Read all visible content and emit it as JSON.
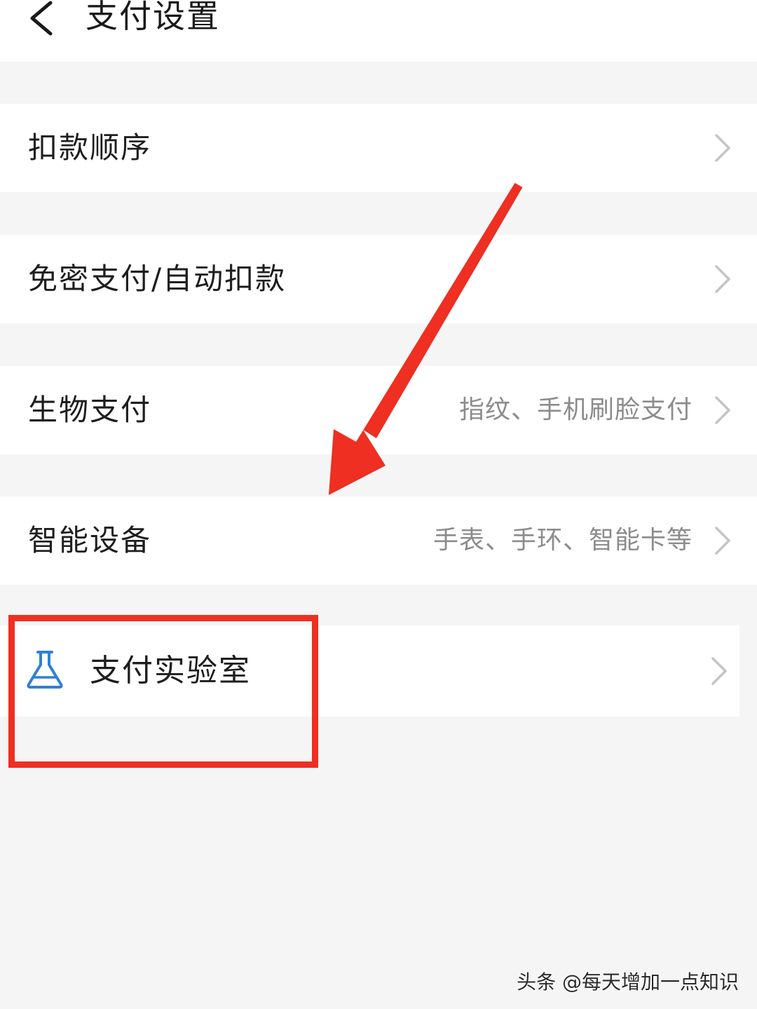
{
  "header": {
    "title": "支付设置",
    "back_icon": "chevron-left-icon"
  },
  "settings": {
    "deduction_order": {
      "label": "扣款顺序"
    },
    "password_free": {
      "label": "免密支付/自动扣款"
    },
    "biometric": {
      "label": "生物支付",
      "value": "指纹、手机刷脸支付"
    },
    "smart_devices": {
      "label": "智能设备",
      "value": "手表、手环、智能卡等"
    },
    "payment_lab": {
      "label": "支付实验室",
      "icon": "flask-icon"
    }
  },
  "annotation": {
    "arrow_color": "#ee2f22",
    "box_color": "#ee2f22"
  },
  "watermark": "头条 @每天增加一点知识",
  "colors": {
    "background": "#f5f5f5",
    "card": "#ffffff",
    "primary_text": "#1e1e1e",
    "secondary_text": "#8c8c8c",
    "chevron": "#c4c4c4",
    "lab_icon": "#2f7fd6"
  }
}
